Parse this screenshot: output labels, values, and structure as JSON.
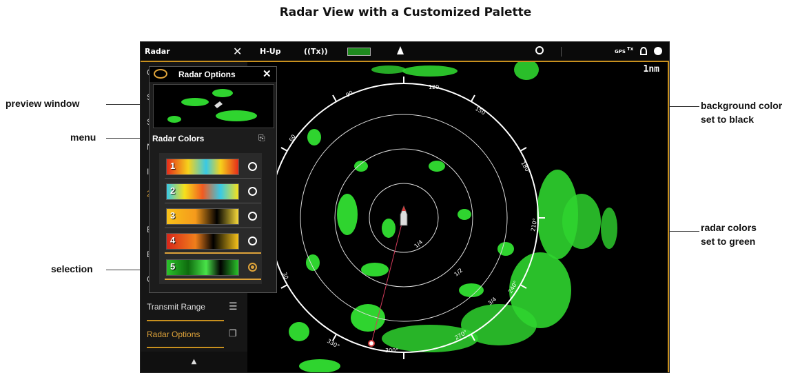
{
  "page_title": "Radar View with a Customized Palette",
  "topbar": {
    "app": "Radar",
    "close_glyph": "✕",
    "orientation": "H-Up",
    "tx": "((Tx))",
    "gps": "GPS",
    "tx_small": "Tx",
    "icons": [
      "gain-bar-icon",
      "heading-arrow-icon",
      "north-compass-icon",
      "gps-icon",
      "transmit-icon",
      "sonar-icon",
      "navigation-icon"
    ]
  },
  "range": "1nm",
  "bearings": [
    "30",
    "60",
    "90",
    "120",
    "150",
    "180°",
    "210°",
    "240°",
    "270°",
    "300°",
    "330°"
  ],
  "ring_labels": [
    "1/4",
    "1/2",
    "3/4"
  ],
  "popup": {
    "title": "Radar Options",
    "close_glyph": "✕",
    "section": "Radar Colors",
    "palettes": [
      {
        "num": "1",
        "selected": false,
        "colors": [
          "#e52b1a",
          "#f6d21b",
          "#38c9e6",
          "#ffffff"
        ]
      },
      {
        "num": "2",
        "selected": false,
        "colors": [
          "#f25a20",
          "#f6e01b",
          "#38c9e6",
          "#ffffff"
        ]
      },
      {
        "num": "3",
        "selected": false,
        "colors": [
          "#f7c11a",
          "#f69a1b",
          "#f7d93a",
          "#000000"
        ]
      },
      {
        "num": "4",
        "selected": false,
        "colors": [
          "#d7261a",
          "#f07f1b",
          "#f6c21b",
          "#000000"
        ]
      },
      {
        "num": "5",
        "selected": true,
        "colors": [
          "#2bc32b",
          "#0e6b0e",
          "#49e349",
          "#000000"
        ]
      }
    ]
  },
  "sidemenu": {
    "items": [
      "Transmit Range",
      "Radar Options"
    ],
    "partial": [
      "C",
      "S",
      "S",
      "N",
      "I",
      "2",
      "E",
      "E",
      "C"
    ],
    "expand_glyph": "▲"
  },
  "callouts": {
    "preview": "preview window",
    "menu": "menu",
    "selection": "selection",
    "background_line1": "background color",
    "background_line2": "set to black",
    "radar_line1": "radar colors",
    "radar_line2": "set to green"
  },
  "colors": {
    "accent": "#c8901e",
    "radar_green": "#2fd42f",
    "background": "#000000"
  }
}
